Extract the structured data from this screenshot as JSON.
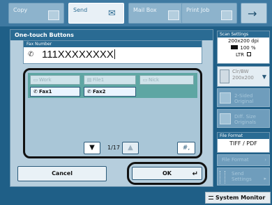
{
  "tabs": [
    {
      "label": "Copy",
      "icon": "copy-icon",
      "active": false
    },
    {
      "label": "Send",
      "icon": "send-icon",
      "active": true
    },
    {
      "label": "Mail Box",
      "icon": "mailbox-icon",
      "active": false
    },
    {
      "label": "Print Job",
      "icon": "printjob-icon",
      "active": false
    }
  ],
  "nav_arrow": "→",
  "dialog": {
    "title": "One-touch Buttons",
    "fax_field_label": "Fax Number",
    "fax_number": "111XXXXXXXX",
    "buttons": [
      {
        "label": "Work",
        "state": "disabled"
      },
      {
        "label": "File1",
        "state": "disabled"
      },
      {
        "label": "Nick",
        "state": "disabled"
      },
      {
        "label": "Fax1",
        "state": "registered"
      },
      {
        "label": "Fax2",
        "state": "registered"
      }
    ],
    "page_indicator": "1/17",
    "down_arrow": "▼",
    "up_arrow": "▲",
    "symbol_button": "#,",
    "cancel_label": "Cancel",
    "ok_label": "OK",
    "ok_return_glyph": "↵"
  },
  "scan_settings": {
    "title": "Scan Settings",
    "resolution": "200x200 dpi",
    "zoom": "100 %",
    "size": "LTR",
    "color_mode_line1": "Clr/BW",
    "color_mode_line2": "200x200",
    "two_sided_line1": "2-Sided",
    "two_sided_line2": "Original",
    "diff_size_line1": "Diff. Size",
    "diff_size_line2": "Originals",
    "file_format_title": "File Format",
    "file_format_value": "TIFF / PDF",
    "file_format_button": "File Format",
    "send_settings_line1": "Send",
    "send_settings_line2": "Settings"
  },
  "system_monitor_label": "System Monitor",
  "colors": {
    "panel": "#1f5f87",
    "dialog": "#b6cedd",
    "header": "#2a6b93",
    "button_area": "#5ea6a3"
  }
}
